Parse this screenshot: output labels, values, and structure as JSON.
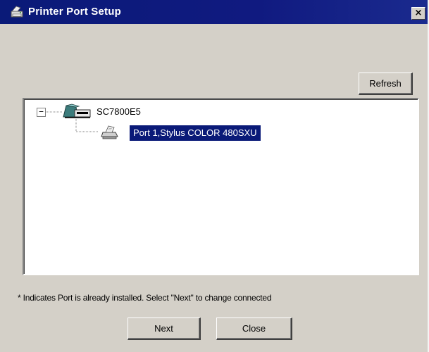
{
  "window": {
    "title": "Printer Port Setup",
    "close_symbol": "×"
  },
  "toolbar": {
    "refresh_label": "Refresh"
  },
  "tree": {
    "root": {
      "expander_symbol": "−",
      "label": "SC7800E5",
      "icon": "network-computer-icon"
    },
    "children": [
      {
        "label": "Port 1,Stylus COLOR 480SXU",
        "icon": "printer-icon",
        "selected": true
      }
    ]
  },
  "status": {
    "message": "* Indicates Port is already installed. Select \"Next\" to change connected"
  },
  "buttons": {
    "next_label": "Next",
    "close_label": "Close"
  },
  "colors": {
    "titlebar": "#0a1a78",
    "dialog_face": "#d4d0c8",
    "selection": "#0a1a78"
  }
}
